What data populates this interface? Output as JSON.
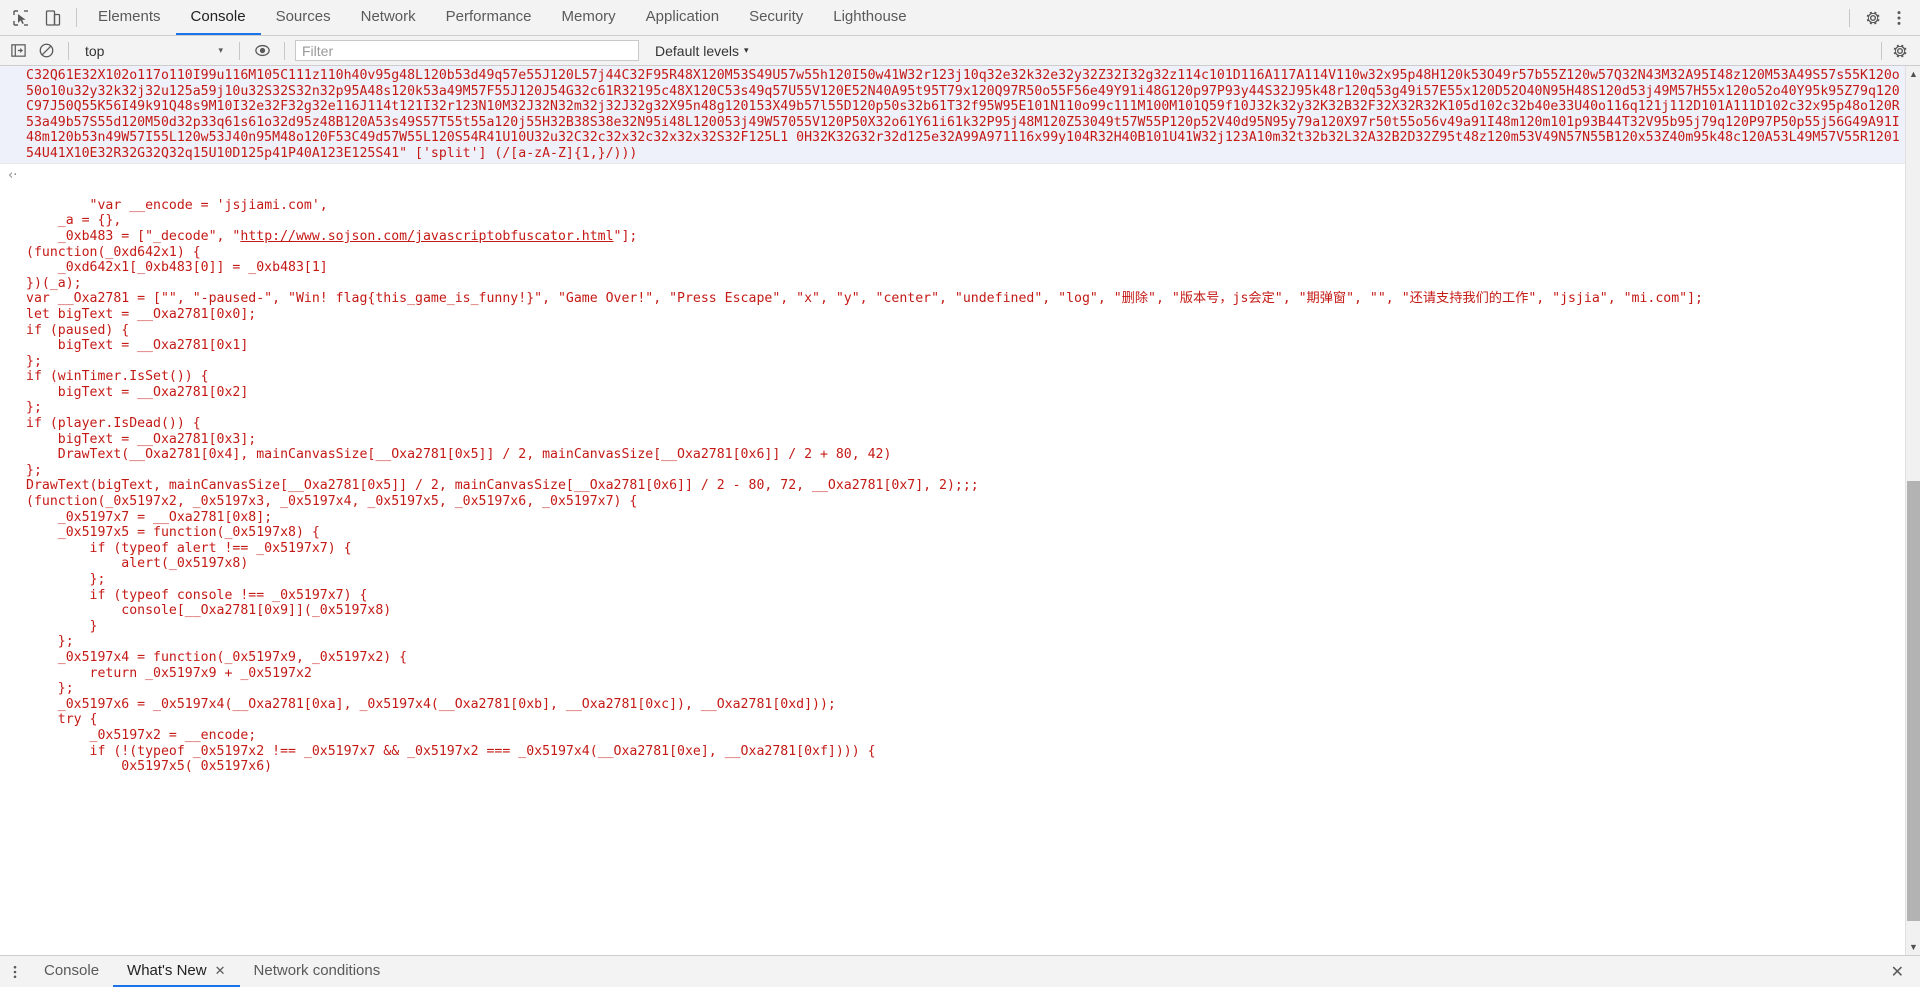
{
  "window": {
    "title": "Chrome DevTools - Console"
  },
  "topbar": {
    "icons": [
      {
        "name": "inspect-element-icon",
        "label": "Inspect element"
      },
      {
        "name": "device-toolbar-icon",
        "label": "Toggle device toolbar"
      }
    ],
    "tabs": [
      {
        "label": "Elements",
        "active": false
      },
      {
        "label": "Console",
        "active": true
      },
      {
        "label": "Sources",
        "active": false
      },
      {
        "label": "Network",
        "active": false
      },
      {
        "label": "Performance",
        "active": false
      },
      {
        "label": "Memory",
        "active": false
      },
      {
        "label": "Application",
        "active": false
      },
      {
        "label": "Security",
        "active": false
      },
      {
        "label": "Lighthouse",
        "active": false
      }
    ],
    "right_icons": [
      {
        "name": "settings-gear-icon",
        "label": "Settings"
      },
      {
        "name": "more-options-icon",
        "label": "Customize and control DevTools"
      }
    ]
  },
  "filterbar": {
    "clear_console_label": "Clear console",
    "sidebar_toggle_label": "Show console sidebar",
    "context_selected": "top",
    "context_caret": "▾",
    "eye_icon_label": "Create live expression",
    "filter_placeholder": "Filter",
    "filter_value": "",
    "levels_label": "Default levels",
    "levels_caret": "▾",
    "settings_label": "Console settings"
  },
  "console": {
    "obfuscated_message": "C32Q61E32X102o117o110I99u116M105C111z110h40v95g48L120b53d49q57e55J120L57j44C32F95R48X120M53S49U57w55h120I50w41W32r123j10q32e32k32e32y32Z32I32g32z114c101D116A117A114V110w32x95p48H120k53O49r57b55Z120w57Q32N43M32A95I48z120M53A49S57s55K120o50o10u32y32k32j32u125a59j10u32S32S32n32p95A48s120k53a49M57F55J120J54G32c61R32195c48X120C53s49q57U55V120E52N40A95t95T79x120Q97R50o55F56e49Y91i48G120p97P93y44S32J95k48r120q53g49i57E55x120D52O40N95H48S120d53j49M57H55x120o52o40Y95k95Z79q120C97J50Q55K56I49k91Q48s9M10I32e32F32g32e116J114t121I32r123N10M32J32N32m32j32J32g32X95n48g120153X49b57l55D120p50s32b61T32f95W95E101N110o99c111M100M101Q59f10J32k32y32K32B32F32X32R32K105d102c32b40e33U40o116q121j112D101A111D102c32x95p48o120R53a49b57S55d120M50d32p33q61s61o32d95z48B120A53s49S57T55t55a120j55H32B38S38e32N95i48L120053j49W57055V120P50X32o61Y61i61k32P95j48M120Z53049t57W55P120p52V40d95N95y79a120X97r50t55o56v49a91I48m120m101p93B44T32V95b95j79q120P97P50p55j56G49A91I48m120b53n49W57I55L120w53J40n95M48o120F53C49d57W55L120S54R41U10U32u32C32c32x32c32x32x32S32F125L1 0H32K32G32r32d125e32A99A971116x99y104R32H40B101U41W32j123A10m32t32b32L32A32B2D32Z95t48z120m53V49N57N55B120x53Z40m95k48c120A53L49M57V55R120154U41X10E32R32G32Q32q15U10D125p41P40A123E125S41\" ['split'] (/[a-zA-Z]{1,}/)))",
    "source_lines": [
      "\"var __encode = 'jsjiami.com',",
      "    _a = {},",
      "    _0xb483 = [\"_decode\", \"http://www.sojson.com/javascriptobfuscator.html\"];",
      "(function(_0xd642x1) {",
      "    _0xd642x1[_0xb483[0]] = _0xb483[1]",
      "})(_a);",
      "var __Oxa2781 = [\"\", \"-paused-\", \"Win! flag{this_game_is_funny!}\", \"Game Over!\", \"Press Escape\", \"x\", \"y\", \"center\", \"undefined\", \"log\", \"删除\", \"版本号，js会定\", \"期弹窗\", \"\", \"还请支持我们的工作\", \"jsjia\", \"mi.com\"];",
      "let bigText = __Oxa2781[0x0];",
      "if (paused) {",
      "    bigText = __Oxa2781[0x1]",
      "};",
      "if (winTimer.IsSet()) {",
      "    bigText = __Oxa2781[0x2]",
      "};",
      "if (player.IsDead()) {",
      "    bigText = __Oxa2781[0x3];",
      "    DrawText(__Oxa2781[0x4], mainCanvasSize[__Oxa2781[0x5]] / 2, mainCanvasSize[__Oxa2781[0x6]] / 2 + 80, 42)",
      "};",
      "DrawText(bigText, mainCanvasSize[__Oxa2781[0x5]] / 2, mainCanvasSize[__Oxa2781[0x6]] / 2 - 80, 72, __Oxa2781[0x7], 2);;;",
      "(function(_0x5197x2, _0x5197x3, _0x5197x4, _0x5197x5, _0x5197x6, _0x5197x7) {",
      "    _0x5197x7 = __Oxa2781[0x8];",
      "    _0x5197x5 = function(_0x5197x8) {",
      "        if (typeof alert !== _0x5197x7) {",
      "            alert(_0x5197x8)",
      "        };",
      "        if (typeof console !== _0x5197x7) {",
      "            console[__Oxa2781[0x9]](_0x5197x8)",
      "        }",
      "    };",
      "    _0x5197x4 = function(_0x5197x9, _0x5197x2) {",
      "        return _0x5197x9 + _0x5197x2",
      "    };",
      "    _0x5197x6 = _0x5197x4(__Oxa2781[0xa], _0x5197x4(__Oxa2781[0xb], __Oxa2781[0xc]), __Oxa2781[0xd]));",
      "    try {",
      "        _0x5197x2 = __encode;",
      "        if (!(typeof _0x5197x2 !== _0x5197x7 && _0x5197x2 === _0x5197x4(__Oxa2781[0xe], __Oxa2781[0xf]))) {",
      "            0x5197x5( 0x5197x6)"
    ],
    "return_arrow": "‹·",
    "link_text": "http://www.sojson.com/javascriptobfuscator.html",
    "link_line_index": 2
  },
  "scrollbar": {
    "up_arrow": "▲",
    "down_arrow": "▼"
  },
  "drawer": {
    "menu_icon": "⋮",
    "tabs": [
      {
        "label": "Console",
        "active": false,
        "closeable": false
      },
      {
        "label": "What's New",
        "active": true,
        "closeable": true,
        "close_glyph": "✕"
      },
      {
        "label": "Network conditions",
        "active": false,
        "closeable": false
      }
    ],
    "close_glyph": "✕"
  },
  "colors": {
    "accent": "#1a73e8",
    "error_text": "#c41a16",
    "chrome_bg": "#f3f3f3",
    "obfuscated_bg": "#eef1fa",
    "border": "#cdcdcd"
  }
}
